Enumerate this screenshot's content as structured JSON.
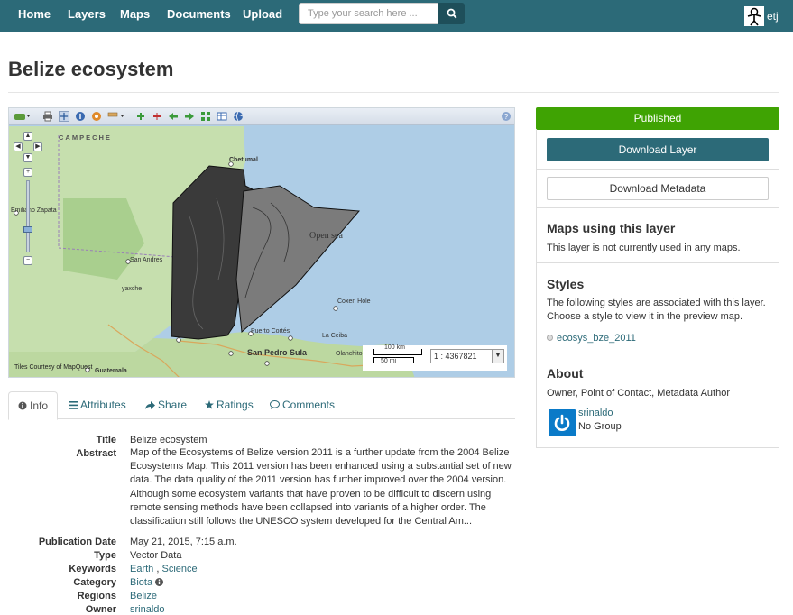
{
  "nav": {
    "home": "Home",
    "layers": "Layers",
    "maps": "Maps",
    "documents": "Documents",
    "upload": "Upload",
    "search_placeholder": "Type your search here ...",
    "user": "etj"
  },
  "page": {
    "title": "Belize ecosystem"
  },
  "map": {
    "labels": {
      "campeche": "CAMPECHE",
      "chetumal": "Chetumal",
      "emiliano_zapata": "Emiliano Zapata",
      "san_andres": "San Andres",
      "yaxche": "yaxche",
      "open_sea": "Open sea",
      "coxen_hole": "Coxen Hole",
      "puerto_cortes": "Puerto Cortés",
      "la_ceiba": "La Ceiba",
      "san_pedro_sula": "San Pedro Sula",
      "olanchito": "Olanchito",
      "guatemala": "Guatemala",
      "tiles_courtesy": "Tiles Courtesy of MapQuest"
    },
    "scale": {
      "km": "100 km",
      "mi": "50 mi",
      "ratio": "1 : 4367821"
    }
  },
  "tabs": {
    "info": "Info",
    "attributes": "Attributes",
    "share": "Share",
    "ratings": "Ratings",
    "comments": "Comments"
  },
  "info": {
    "title_label": "Title",
    "title_value": "Belize ecosystem",
    "abstract_label": "Abstract",
    "abstract_value": "Map of the Ecosystems of Belize version 2011 is a further update from the 2004 Belize Ecosystems Map. This 2011 version has been enhanced using a substantial set of new data. The data quality of the 2011 version has further improved over the 2004 version. Although some ecosystem variants that have proven to be difficult to discern using remote sensing methods have been collapsed into variants of a higher order. The classification still follows the UNESCO system developed for the Central Am...",
    "pubdate_label": "Publication Date",
    "pubdate_value": "May 21, 2015, 7:15 a.m.",
    "type_label": "Type",
    "type_value": "Vector Data",
    "keywords_label": "Keywords",
    "keyword_1": "Earth",
    "keyword_sep": ",",
    "keyword_2": "Science",
    "category_label": "Category",
    "category_value": "Biota",
    "regions_label": "Regions",
    "regions_value": "Belize",
    "owner_label": "Owner",
    "owner_value": "srinaldo"
  },
  "sidebar": {
    "status": "Published",
    "download_layer": "Download Layer",
    "download_metadata": "Download Metadata",
    "maps_heading": "Maps using this layer",
    "maps_text": "This layer is not currently used in any maps.",
    "styles_heading": "Styles",
    "styles_text": "The following styles are associated with this layer. Choose a style to view it in the preview map.",
    "style_name": "ecosys_bze_2011",
    "about_heading": "About",
    "about_roles": "Owner, Point of Contact, Metadata Author",
    "owner_name": "srinaldo",
    "owner_group": "No Group"
  },
  "colors": {
    "navbar": "#2c6a78",
    "published": "#3fa303",
    "link": "#2c6a78",
    "sea": "#aecde6",
    "land": "#c6dfae"
  }
}
